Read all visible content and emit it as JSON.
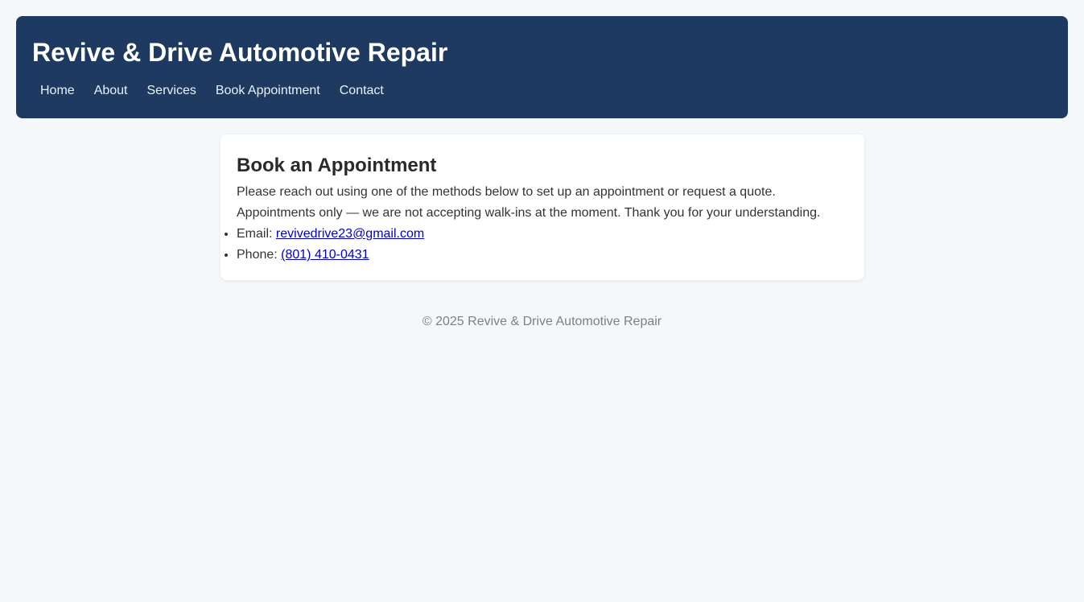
{
  "header": {
    "title": "Revive & Drive Automotive Repair",
    "nav": [
      {
        "label": "Home"
      },
      {
        "label": "About"
      },
      {
        "label": "Services"
      },
      {
        "label": "Book Appointment"
      },
      {
        "label": "Contact"
      }
    ]
  },
  "card": {
    "title": "Book an Appointment",
    "intro": "Please reach out using one of the methods below to set up an appointment or request a quote.",
    "notice": "Appointments only — we are not accepting walk-ins at the moment. Thank you for your understanding.",
    "contacts": [
      {
        "label": "Email: ",
        "value": "revivedrive23@gmail.com"
      },
      {
        "label": "Phone: ",
        "value": "(801) 410-0431"
      }
    ]
  },
  "footer": {
    "text": "© 2025 Revive & Drive Automotive Repair"
  },
  "colors": {
    "header_bg": "#1f3a60",
    "page_bg": "#f4f8fb",
    "link": "#0000cc"
  }
}
